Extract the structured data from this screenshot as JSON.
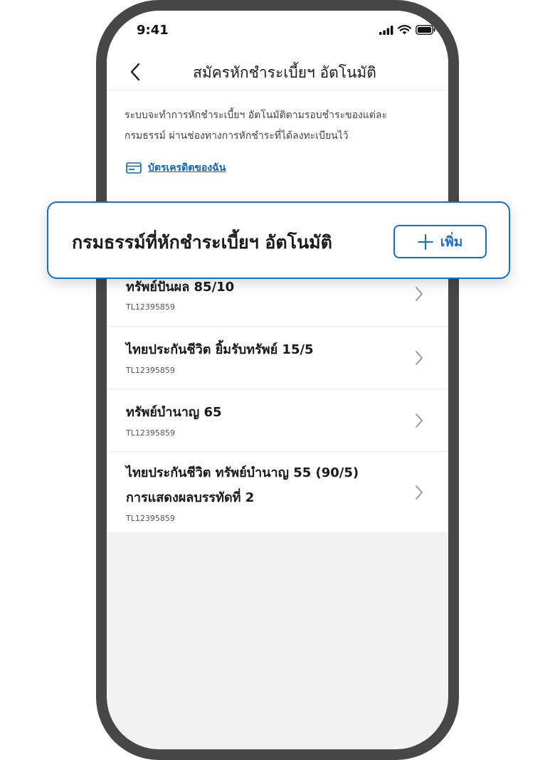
{
  "status_bar": {
    "time": "9:41"
  },
  "nav": {
    "title": "สมัครหักชำระเบี้ยฯ อัตโนมัติ"
  },
  "description": "ระบบจะทำการหักชำระเบี้ยฯ อัตโนมัติตามรอบชำระของแต่ละกรมธรรม์ ผ่านช่องทางการหักชำระที่ได้ลงทะเบียนไว้",
  "card_link": {
    "label": "บัตรเครดิตของฉัน",
    "icon": "credit-card-icon"
  },
  "section": {
    "title": "กรมธรรม์ที่หักชำระเบี้ยฯ อัตโนมัติ",
    "add_label": "เพิ่ม"
  },
  "policies": [
    {
      "name": "ทรัพย์ปันผล 85/10",
      "number": "TL12395859"
    },
    {
      "name": "ไทยประกันชีวิต ยิ้มรับทรัพย์ 15/5",
      "number": "TL12395859"
    },
    {
      "name": "ทรัพย์บำนาญ 65",
      "number": "TL12395859"
    },
    {
      "name_line1": "ไทยประกันชีวิต ทรัพย์บำนาญ 55 (90/5)",
      "name_line2": "การแสดงผลบรรทัดที่ 2",
      "number": "TL12395859"
    }
  ],
  "colors": {
    "accent": "#1a6fbf",
    "link": "#0b66b2",
    "frame": "#474747",
    "background": "#f2f2f2"
  }
}
